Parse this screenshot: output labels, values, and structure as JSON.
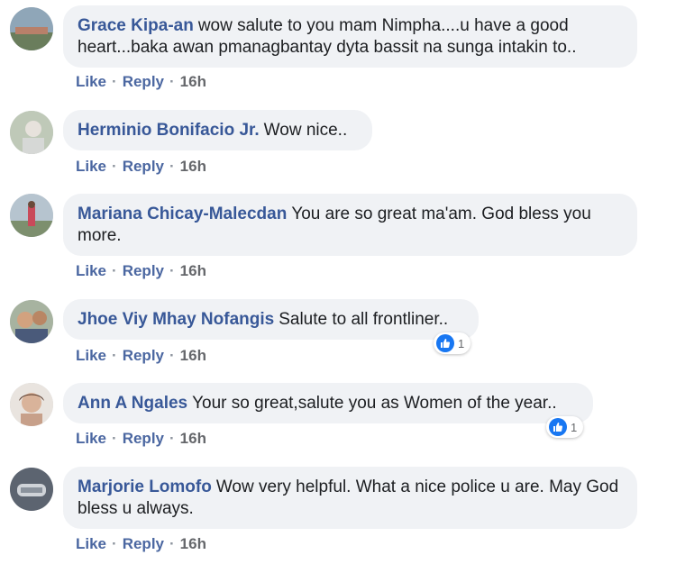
{
  "accent_color": "#385898",
  "comments": [
    {
      "author": "Grace Kipa-an",
      "text": "wow salute to you mam Nimpha....u have a good heart...baka awan pmanagbantay dyta bassit na sunga intakin to..",
      "like_label": "Like",
      "reply_label": "Reply",
      "time": "16h"
    },
    {
      "author": "Herminio Bonifacio Jr.",
      "text": "Wow nice..",
      "like_label": "Like",
      "reply_label": "Reply",
      "time": "16h"
    },
    {
      "author": "Mariana Chicay-Malecdan",
      "text": "You are so great ma'am. God bless you more.",
      "like_label": "Like",
      "reply_label": "Reply",
      "time": "16h"
    },
    {
      "author": "Jhoe Viy Mhay Nofangis",
      "text": "Salute to all frontliner..",
      "like_label": "Like",
      "reply_label": "Reply",
      "time": "16h",
      "reaction_icon": "thumbs-up-icon",
      "reaction_count": "1"
    },
    {
      "author": "Ann A Ngales",
      "text": "Your so great,salute you as Women of the year..",
      "like_label": "Like",
      "reply_label": "Reply",
      "time": "16h",
      "reaction_icon": "thumbs-up-icon",
      "reaction_count": "1"
    },
    {
      "author": "Marjorie Lomofo",
      "text": "Wow very helpful. What a nice police u are. May God bless u always.",
      "like_label": "Like",
      "reply_label": "Reply",
      "time": "16h"
    }
  ]
}
